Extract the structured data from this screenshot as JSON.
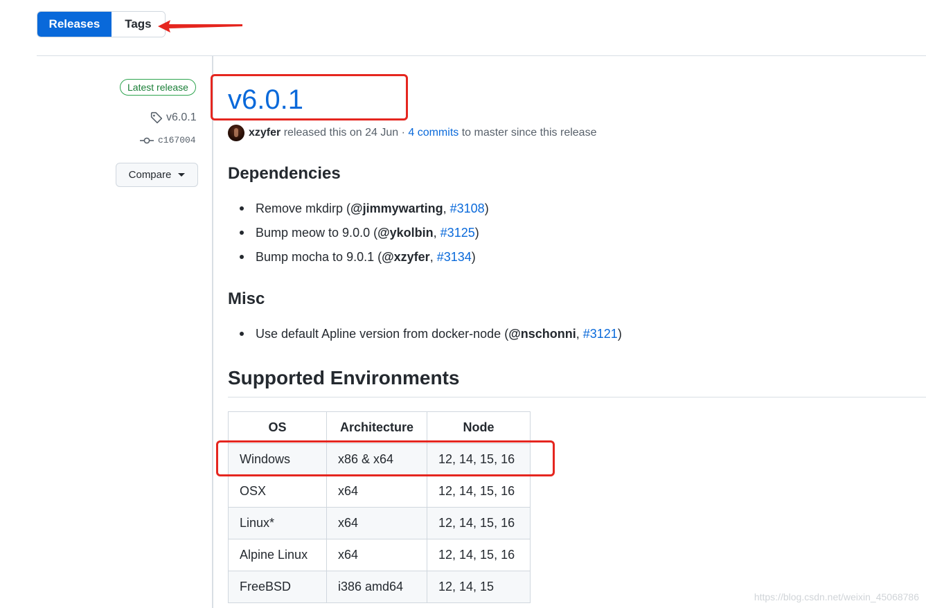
{
  "tabs": {
    "releases": "Releases",
    "tags": "Tags"
  },
  "sidebar": {
    "latest_badge": "Latest release",
    "tag": "v6.0.1",
    "commit": "c167004",
    "compare_label": "Compare"
  },
  "release": {
    "title": "v6.0.1",
    "author": "xzyfer",
    "released_text": " released this on 24 Jun · ",
    "commits_link": "4 commits",
    "commits_suffix": " to master since this release"
  },
  "sections": {
    "dependencies": {
      "heading": "Dependencies",
      "items": [
        {
          "text": "Remove mkdirp (",
          "user": "@jimmywarting",
          "sep": ", ",
          "pr": "#3108",
          "end": ")"
        },
        {
          "text": "Bump meow to 9.0.0 (",
          "user": "@ykolbin",
          "sep": ", ",
          "pr": "#3125",
          "end": ")"
        },
        {
          "text": "Bump mocha to 9.0.1 (",
          "user": "@xzyfer",
          "sep": ", ",
          "pr": "#3134",
          "end": ")"
        }
      ]
    },
    "misc": {
      "heading": "Misc",
      "items": [
        {
          "text": "Use default Apline version from docker-node (",
          "user": "@nschonni",
          "sep": ", ",
          "pr": "#3121",
          "end": ")"
        }
      ]
    },
    "environments": {
      "heading": "Supported Environments",
      "columns": [
        "OS",
        "Architecture",
        "Node"
      ],
      "rows": [
        [
          "Windows",
          "x86 & x64",
          "12, 14, 15, 16"
        ],
        [
          "OSX",
          "x64",
          "12, 14, 15, 16"
        ],
        [
          "Linux*",
          "x64",
          "12, 14, 15, 16"
        ],
        [
          "Alpine Linux",
          "x64",
          "12, 14, 15, 16"
        ],
        [
          "FreeBSD",
          "i386 amd64",
          "12, 14, 15"
        ]
      ]
    }
  },
  "watermark": "https://blog.csdn.net/weixin_45068786",
  "colors": {
    "accent": "#0969da",
    "annotation": "#e5261f",
    "badge": "#1a7f37"
  }
}
